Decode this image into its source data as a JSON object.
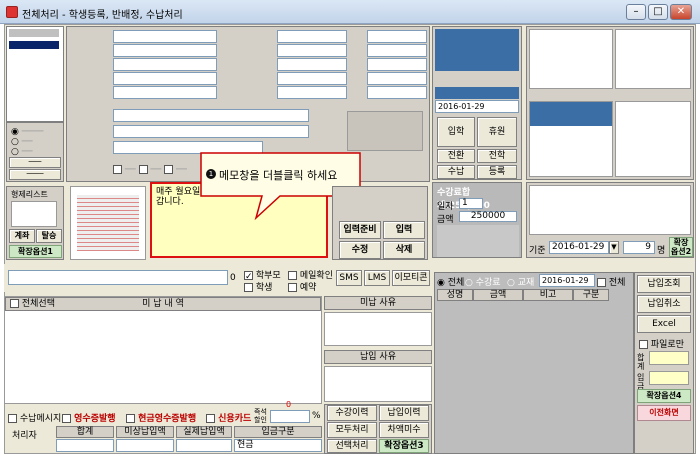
{
  "window": {
    "title": "전체처리 - 학생등록, 반배정, 수납처리"
  },
  "student_panel": {
    "list_header": "",
    "student_list_btn": "형제리스트",
    "calc_btn": "계좌",
    "withdraw_btn": "탈승",
    "ext1_btn": "확장옵션1"
  },
  "memo": {
    "text": "매주 월요일 ... 갑니다.",
    "callout": "메모창을 더블클릭 하세요",
    "callout_num": "1"
  },
  "actions": {
    "register_prepare": "입력준비",
    "input": "입력",
    "edit": "수정",
    "delete": "삭제"
  },
  "tuition": {
    "total_label": "수강료합계",
    "total_value": "250,000",
    "count_label": "일자",
    "count_value": "1",
    "amount_label": "금액",
    "amount_value": "250000",
    "period_label": "기준",
    "period_value": "2016-01-29",
    "period_num": "9",
    "period_unit": "명",
    "ext2": "확장옵션2",
    "date_field": "2016-01-29"
  },
  "mid_buttons": {
    "b1": "입학",
    "b2": "휴원",
    "b3": "전환",
    "b4": "전학",
    "b5": "수납",
    "b6": "등록"
  },
  "sms_row": {
    "count": "0",
    "parent": "학부모",
    "student": "학생",
    "disp_send": "메일확인",
    "reserve": "예약",
    "sms": "SMS",
    "lms": "LMS",
    "emoticon": "이모티콘"
  },
  "unpaid": {
    "check_all": "전체선택",
    "header": "미 납 내 역",
    "unpaid_reason": "미납 사유",
    "paid_reason": "납입 사유"
  },
  "options": {
    "receipt_msg": "수납메시지",
    "cash_issue": "영수증발행",
    "cash_receipt": "현금영수증발행",
    "credit_card": "신용카드",
    "discount": "즉석할인",
    "discount_val": "0",
    "pct": "%"
  },
  "bottom": {
    "handler": "처리자",
    "cols": [
      "합계",
      "미상납입액",
      "실제납입액",
      "입금구분"
    ],
    "pay_type": "현금",
    "attend": "수강이력",
    "payment_history": "납입이력",
    "all_process": "모두처리",
    "diff_pay": "차액미수",
    "select_process": "선택처리",
    "ext3": "확장옵션3"
  },
  "right": {
    "tabs": [
      "전체",
      "수강료",
      "교재"
    ],
    "date": "2016-01-29",
    "all": "전체",
    "cols": [
      "성명",
      "금액",
      "비고",
      "구분"
    ],
    "lookup": "납입조회",
    "cancel": "납입취소",
    "excel": "Excel",
    "file_only": "파일로만",
    "sum_label1": "합계",
    "sum_label2": "입금",
    "ext4": "확장옵션4",
    "prev_screen": "이전화면"
  }
}
